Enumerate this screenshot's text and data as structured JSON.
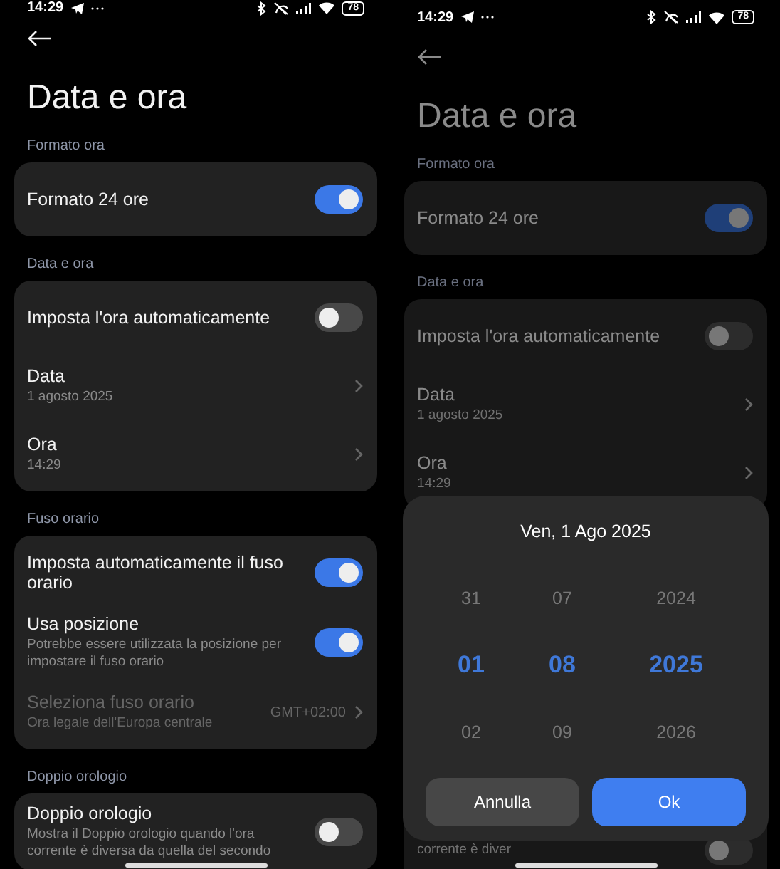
{
  "screens": [
    {
      "status_bar": {
        "time": "14:29",
        "battery": "78"
      },
      "title": "Data e ora",
      "dimmed": false,
      "sections": [
        {
          "header": "Formato ora",
          "items": [
            {
              "kind": "toggle",
              "label": "Formato 24 ore",
              "on": true,
              "disabled": false
            }
          ]
        },
        {
          "header": "Data e ora",
          "items": [
            {
              "kind": "toggle",
              "label": "Imposta l'ora automaticamente",
              "on": false,
              "disabled": false
            },
            {
              "kind": "link",
              "label": "Data",
              "subtitle": "1 agosto 2025",
              "disabled": false
            },
            {
              "kind": "link",
              "label": "Ora",
              "subtitle": "14:29",
              "disabled": false
            }
          ]
        },
        {
          "header": "Fuso orario",
          "items": [
            {
              "kind": "toggle",
              "label": "Imposta automaticamente il fuso orario",
              "on": true,
              "disabled": false
            },
            {
              "kind": "toggle",
              "label": "Usa posizione",
              "subtitle": "Potrebbe essere utilizzata la posizione per impostare il fuso orario",
              "on": true,
              "disabled": false
            },
            {
              "kind": "link",
              "label": "Seleziona fuso orario",
              "subtitle": "Ora legale dell'Europa centrale",
              "value": "GMT+02:00",
              "disabled": true
            }
          ]
        },
        {
          "header": "Doppio orologio",
          "items": [
            {
              "kind": "toggle",
              "label": "Doppio orologio",
              "subtitle": "Mostra il Doppio orologio quando l'ora corrente è diversa da quella del secondo",
              "on": false,
              "disabled": false
            }
          ]
        }
      ]
    },
    {
      "status_bar": {
        "time": "14:29",
        "battery": "78"
      },
      "title": "Data e ora",
      "dimmed": true,
      "sections": [
        {
          "header": "Formato ora",
          "items": [
            {
              "kind": "toggle",
              "label": "Formato 24 ore",
              "on": true,
              "disabled": false
            }
          ]
        },
        {
          "header": "Data e ora",
          "items": [
            {
              "kind": "toggle",
              "label": "Imposta l'ora automaticamente",
              "on": false,
              "disabled": false
            },
            {
              "kind": "link",
              "label": "Data",
              "subtitle": "1 agosto 2025",
              "disabled": false
            },
            {
              "kind": "link",
              "label": "Ora",
              "subtitle": "14:29",
              "disabled": false
            }
          ]
        }
      ],
      "tail": {
        "kind": "toggle",
        "subtitle": "corrente è diver",
        "on": false
      },
      "dialog": {
        "title": "Ven, 1 Ago 2025",
        "columns": [
          [
            {
              "label": "31",
              "selected": false
            },
            {
              "label": "01",
              "selected": true
            },
            {
              "label": "02",
              "selected": false
            }
          ],
          [
            {
              "label": "07",
              "selected": false
            },
            {
              "label": "08",
              "selected": true
            },
            {
              "label": "09",
              "selected": false
            }
          ],
          [
            {
              "label": "2024",
              "selected": false
            },
            {
              "label": "2025",
              "selected": true
            },
            {
              "label": "2026",
              "selected": false
            }
          ]
        ],
        "cancel": "Annulla",
        "confirm": "Ok"
      }
    }
  ]
}
